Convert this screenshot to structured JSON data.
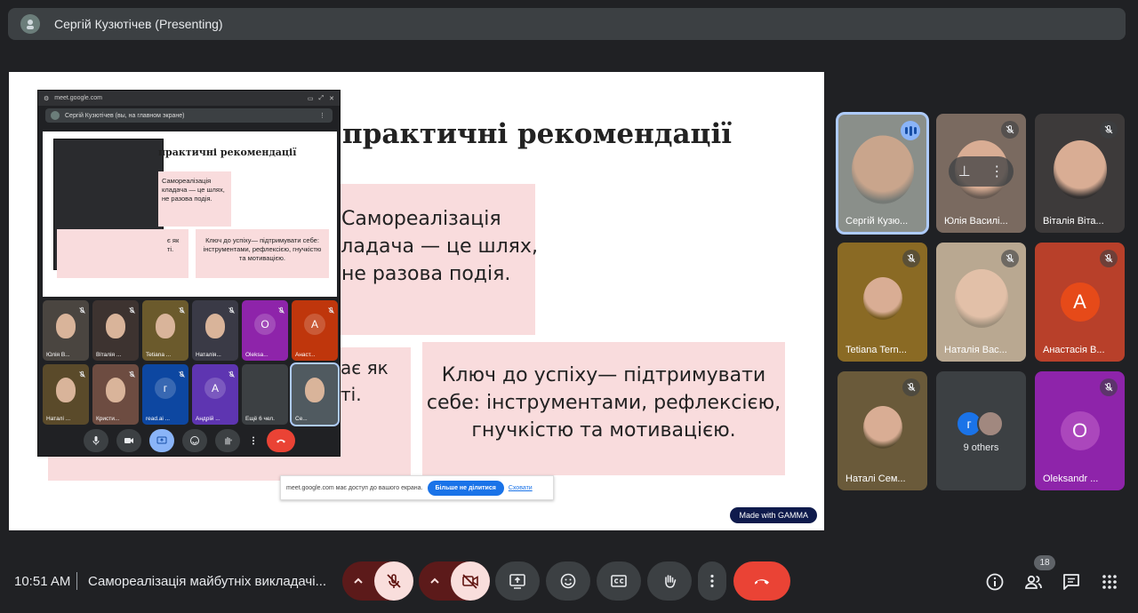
{
  "header": {
    "presenter_title": "Сергій Кузютічев (Presenting)"
  },
  "slide": {
    "title": "практичні рекомендації",
    "card1_lines": [
      "Самореалізація",
      "кладача — це шлях,",
      "не разова подія."
    ],
    "card2_lines": [
      "Ключ до успіху— підтримувати",
      "себе: інструментами, рефлексією,",
      "гнучкістю та мотивацією."
    ],
    "card3_lines": [
      "ає як",
      "ті."
    ],
    "made_with": "Made with GAMMA"
  },
  "pip": {
    "url": "meet.google.com",
    "presenter_label": "Сергій Кузютічев (вы, на главном экране)",
    "slide_title": "практичні рекомендації",
    "card1": "Самореалізація кладача — це шлях, не разова подія.",
    "card2": "Ключ до успіху— підтримувати себе: інструментами, рефлексією, гнучкістю та мотивацією.",
    "card3": "є як ті.",
    "tiles": [
      {
        "name": "Юлія В...",
        "letter": "",
        "bg": "#4a4540"
      },
      {
        "name": "Віталія ...",
        "letter": "",
        "bg": "#3d3330"
      },
      {
        "name": "Tetiana ...",
        "letter": "",
        "bg": "#6b5a2c"
      },
      {
        "name": "Наталія...",
        "letter": "",
        "bg": "#3a3a46"
      },
      {
        "name": "Oleksa...",
        "letter": "O",
        "bg": "#8e24aa"
      },
      {
        "name": "Анаст...",
        "letter": "A",
        "bg": "#bf360c"
      },
      {
        "name": "Наталі ...",
        "letter": "",
        "bg": "#5a4a2a"
      },
      {
        "name": "Кристи...",
        "letter": "",
        "bg": "#6d4c41"
      },
      {
        "name": "read.ai ...",
        "letter": "г",
        "bg": "#0d47a1"
      },
      {
        "name": "Андрій ...",
        "letter": "A",
        "bg": "#5e35b1"
      },
      {
        "name": "Ещё 6 чел.",
        "letter": "",
        "bg": "#3c4043"
      },
      {
        "name": "Се...",
        "letter": "",
        "bg": "#505a60"
      }
    ]
  },
  "share_notice": {
    "text": "meet.google.com має доступ до вашого екрана.",
    "stop_label": "Більше не ділитися",
    "hide_label": "Сховати"
  },
  "participants": [
    {
      "name": "Сергій Кузю...",
      "type": "video",
      "bg": "#8a8f8a",
      "muted": false,
      "active": true
    },
    {
      "name": "Юлія Василі...",
      "type": "video",
      "bg": "#7a6a60",
      "muted": true,
      "active": false
    },
    {
      "name": "Віталія Віта...",
      "type": "video",
      "bg": "#3d3a3a",
      "muted": true,
      "active": false
    },
    {
      "name": "Tetiana Tern...",
      "type": "video",
      "bg": "#8a6a24",
      "muted": true,
      "active": false
    },
    {
      "name": "Наталія Вас...",
      "type": "video",
      "bg": "#b9a891",
      "muted": true,
      "active": false
    },
    {
      "name": "Анастасія В...",
      "type": "letter",
      "letter": "A",
      "bg": "#b8402a",
      "letterBg": "#e64a19",
      "muted": true,
      "active": false
    },
    {
      "name": "Наталі Сем...",
      "type": "video",
      "bg": "#6a5a3a",
      "muted": true,
      "active": false
    },
    {
      "name": "Oleksandr ...",
      "type": "letter",
      "letter": "O",
      "bg": "#8e24aa",
      "letterBg": "#ab47bc",
      "muted": true,
      "active": false
    }
  ],
  "others": {
    "label": "9 others",
    "avatar_letter": "г"
  },
  "bottom": {
    "time": "10:51 AM",
    "meeting_title": "Самореалізація майбутніх викладачі...",
    "people_count": "18"
  },
  "colors": {
    "accent_blue": "#8ab4f8",
    "end_red": "#ea4335",
    "muted_bg": "#f9dedc"
  }
}
